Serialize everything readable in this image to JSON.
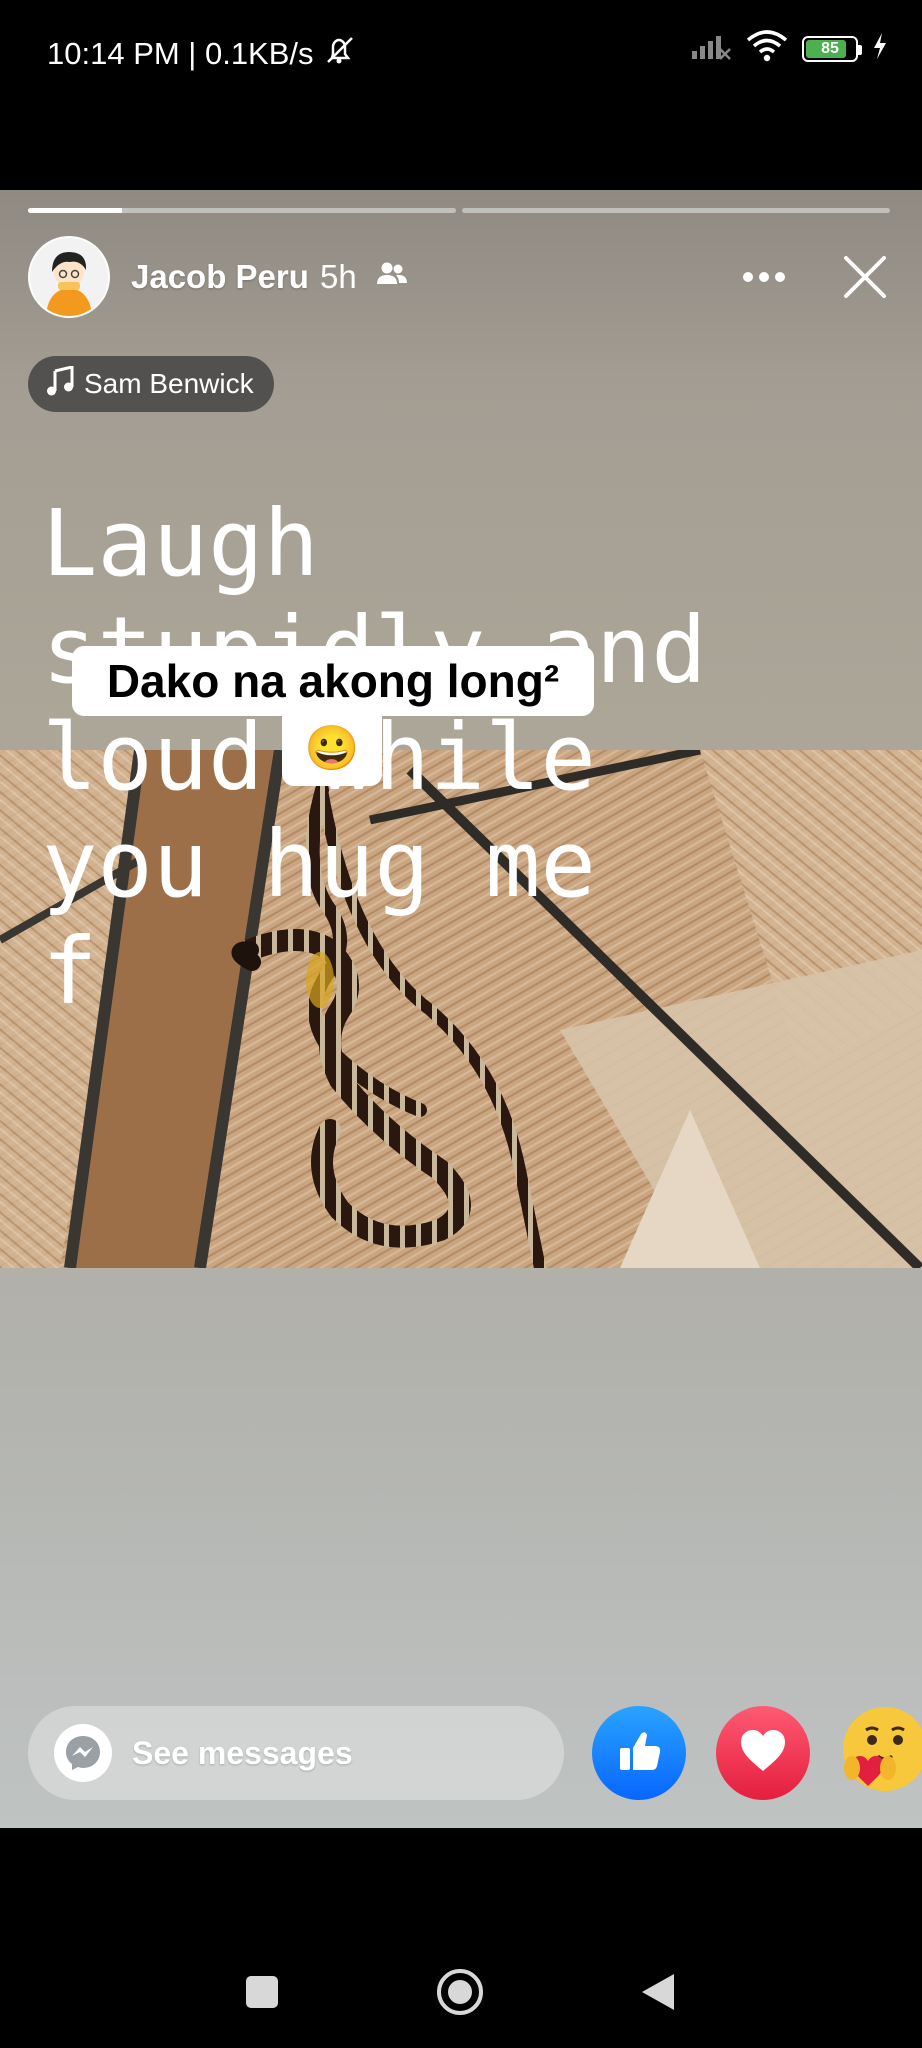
{
  "status_bar": {
    "time": "10:14 PM | 0.1KB/s",
    "battery_level": "85",
    "icons": [
      "mute-icon",
      "signal-icon",
      "wifi-icon",
      "battery-icon",
      "charging-icon"
    ]
  },
  "story": {
    "progress": {
      "segments": 2,
      "current_segment_fraction": 0.22
    },
    "author": "Jacob Peru",
    "time_ago": "5h",
    "audience_icon": "friends-icon",
    "music": "Sam Benwick",
    "overlay_text": "Laugh\nstupidly and\nloud while\nyou hug me\nf",
    "sticker_text": "Dako na akong long²",
    "sticker_emoji": "😀"
  },
  "bottom_bar": {
    "messages_label": "See messages",
    "reactions": [
      "like",
      "love",
      "care"
    ]
  },
  "colors": {
    "like_blue": "#0866ff",
    "love_red": "#e41e3f",
    "battery_green": "#4caf50"
  }
}
